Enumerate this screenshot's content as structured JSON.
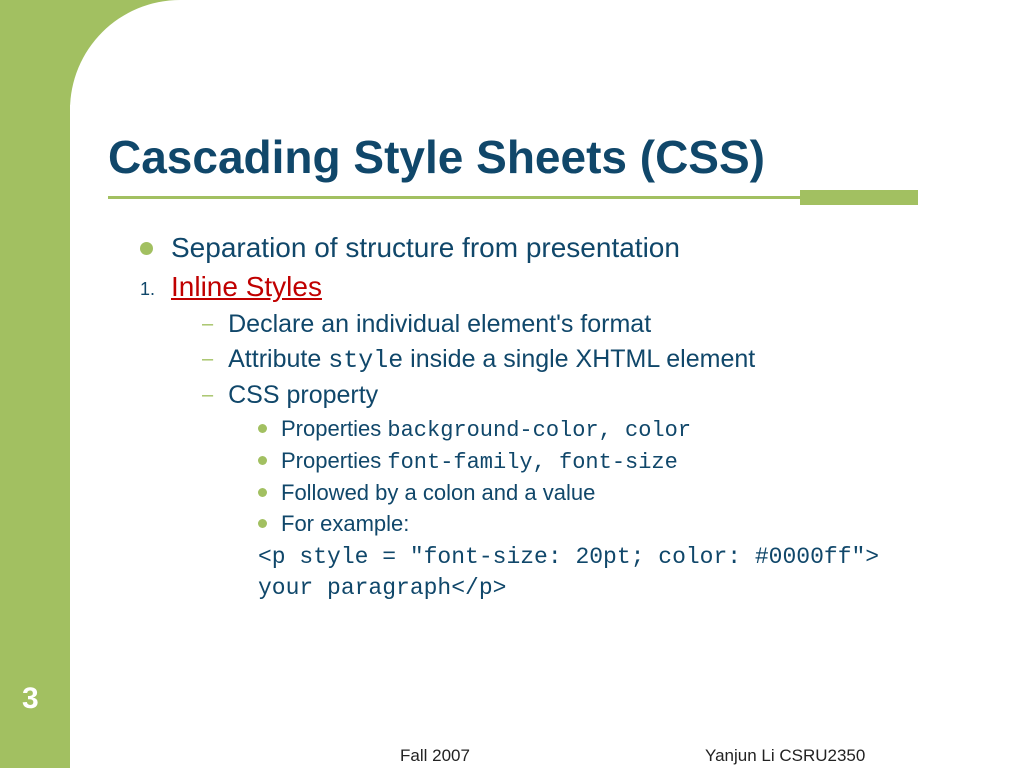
{
  "title": "Cascading Style Sheets (CSS)",
  "main_bullet": "Separation of structure from presentation",
  "numbered_label": "1.",
  "numbered_text": "Inline Styles",
  "sub_items": {
    "a": "Declare an individual element's format",
    "b_prefix": "Attribute ",
    "b_code": "style",
    "b_suffix": "  inside a single XHTML element",
    "c": "CSS property"
  },
  "subsub_items": {
    "a_prefix": "Properties ",
    "a_code": "background-color, color",
    "b_prefix": "Properties ",
    "b_code": "font-family, font-size",
    "c": "Followed by a colon and a value",
    "d": "For example:"
  },
  "code_example": {
    "line1": "<p style = \"font-size: 20pt; color: #0000ff\">",
    "line2": " your paragraph</p>"
  },
  "page_number": "3",
  "footer_center": "Fall 2007",
  "footer_right": "Yanjun Li    CSRU2350"
}
